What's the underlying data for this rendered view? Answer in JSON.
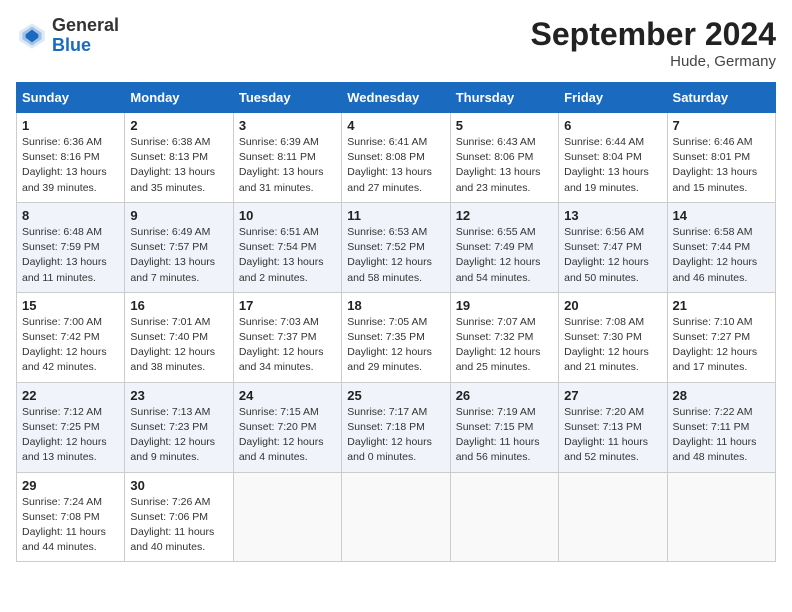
{
  "header": {
    "logo_general": "General",
    "logo_blue": "Blue",
    "month_title": "September 2024",
    "location": "Hude, Germany"
  },
  "weekdays": [
    "Sunday",
    "Monday",
    "Tuesday",
    "Wednesday",
    "Thursday",
    "Friday",
    "Saturday"
  ],
  "weeks": [
    [
      {
        "day": "1",
        "info": "Sunrise: 6:36 AM\nSunset: 8:16 PM\nDaylight: 13 hours\nand 39 minutes."
      },
      {
        "day": "2",
        "info": "Sunrise: 6:38 AM\nSunset: 8:13 PM\nDaylight: 13 hours\nand 35 minutes."
      },
      {
        "day": "3",
        "info": "Sunrise: 6:39 AM\nSunset: 8:11 PM\nDaylight: 13 hours\nand 31 minutes."
      },
      {
        "day": "4",
        "info": "Sunrise: 6:41 AM\nSunset: 8:08 PM\nDaylight: 13 hours\nand 27 minutes."
      },
      {
        "day": "5",
        "info": "Sunrise: 6:43 AM\nSunset: 8:06 PM\nDaylight: 13 hours\nand 23 minutes."
      },
      {
        "day": "6",
        "info": "Sunrise: 6:44 AM\nSunset: 8:04 PM\nDaylight: 13 hours\nand 19 minutes."
      },
      {
        "day": "7",
        "info": "Sunrise: 6:46 AM\nSunset: 8:01 PM\nDaylight: 13 hours\nand 15 minutes."
      }
    ],
    [
      {
        "day": "8",
        "info": "Sunrise: 6:48 AM\nSunset: 7:59 PM\nDaylight: 13 hours\nand 11 minutes."
      },
      {
        "day": "9",
        "info": "Sunrise: 6:49 AM\nSunset: 7:57 PM\nDaylight: 13 hours\nand 7 minutes."
      },
      {
        "day": "10",
        "info": "Sunrise: 6:51 AM\nSunset: 7:54 PM\nDaylight: 13 hours\nand 2 minutes."
      },
      {
        "day": "11",
        "info": "Sunrise: 6:53 AM\nSunset: 7:52 PM\nDaylight: 12 hours\nand 58 minutes."
      },
      {
        "day": "12",
        "info": "Sunrise: 6:55 AM\nSunset: 7:49 PM\nDaylight: 12 hours\nand 54 minutes."
      },
      {
        "day": "13",
        "info": "Sunrise: 6:56 AM\nSunset: 7:47 PM\nDaylight: 12 hours\nand 50 minutes."
      },
      {
        "day": "14",
        "info": "Sunrise: 6:58 AM\nSunset: 7:44 PM\nDaylight: 12 hours\nand 46 minutes."
      }
    ],
    [
      {
        "day": "15",
        "info": "Sunrise: 7:00 AM\nSunset: 7:42 PM\nDaylight: 12 hours\nand 42 minutes."
      },
      {
        "day": "16",
        "info": "Sunrise: 7:01 AM\nSunset: 7:40 PM\nDaylight: 12 hours\nand 38 minutes."
      },
      {
        "day": "17",
        "info": "Sunrise: 7:03 AM\nSunset: 7:37 PM\nDaylight: 12 hours\nand 34 minutes."
      },
      {
        "day": "18",
        "info": "Sunrise: 7:05 AM\nSunset: 7:35 PM\nDaylight: 12 hours\nand 29 minutes."
      },
      {
        "day": "19",
        "info": "Sunrise: 7:07 AM\nSunset: 7:32 PM\nDaylight: 12 hours\nand 25 minutes."
      },
      {
        "day": "20",
        "info": "Sunrise: 7:08 AM\nSunset: 7:30 PM\nDaylight: 12 hours\nand 21 minutes."
      },
      {
        "day": "21",
        "info": "Sunrise: 7:10 AM\nSunset: 7:27 PM\nDaylight: 12 hours\nand 17 minutes."
      }
    ],
    [
      {
        "day": "22",
        "info": "Sunrise: 7:12 AM\nSunset: 7:25 PM\nDaylight: 12 hours\nand 13 minutes."
      },
      {
        "day": "23",
        "info": "Sunrise: 7:13 AM\nSunset: 7:23 PM\nDaylight: 12 hours\nand 9 minutes."
      },
      {
        "day": "24",
        "info": "Sunrise: 7:15 AM\nSunset: 7:20 PM\nDaylight: 12 hours\nand 4 minutes."
      },
      {
        "day": "25",
        "info": "Sunrise: 7:17 AM\nSunset: 7:18 PM\nDaylight: 12 hours\nand 0 minutes."
      },
      {
        "day": "26",
        "info": "Sunrise: 7:19 AM\nSunset: 7:15 PM\nDaylight: 11 hours\nand 56 minutes."
      },
      {
        "day": "27",
        "info": "Sunrise: 7:20 AM\nSunset: 7:13 PM\nDaylight: 11 hours\nand 52 minutes."
      },
      {
        "day": "28",
        "info": "Sunrise: 7:22 AM\nSunset: 7:11 PM\nDaylight: 11 hours\nand 48 minutes."
      }
    ],
    [
      {
        "day": "29",
        "info": "Sunrise: 7:24 AM\nSunset: 7:08 PM\nDaylight: 11 hours\nand 44 minutes."
      },
      {
        "day": "30",
        "info": "Sunrise: 7:26 AM\nSunset: 7:06 PM\nDaylight: 11 hours\nand 40 minutes."
      },
      {
        "day": "",
        "info": ""
      },
      {
        "day": "",
        "info": ""
      },
      {
        "day": "",
        "info": ""
      },
      {
        "day": "",
        "info": ""
      },
      {
        "day": "",
        "info": ""
      }
    ]
  ]
}
